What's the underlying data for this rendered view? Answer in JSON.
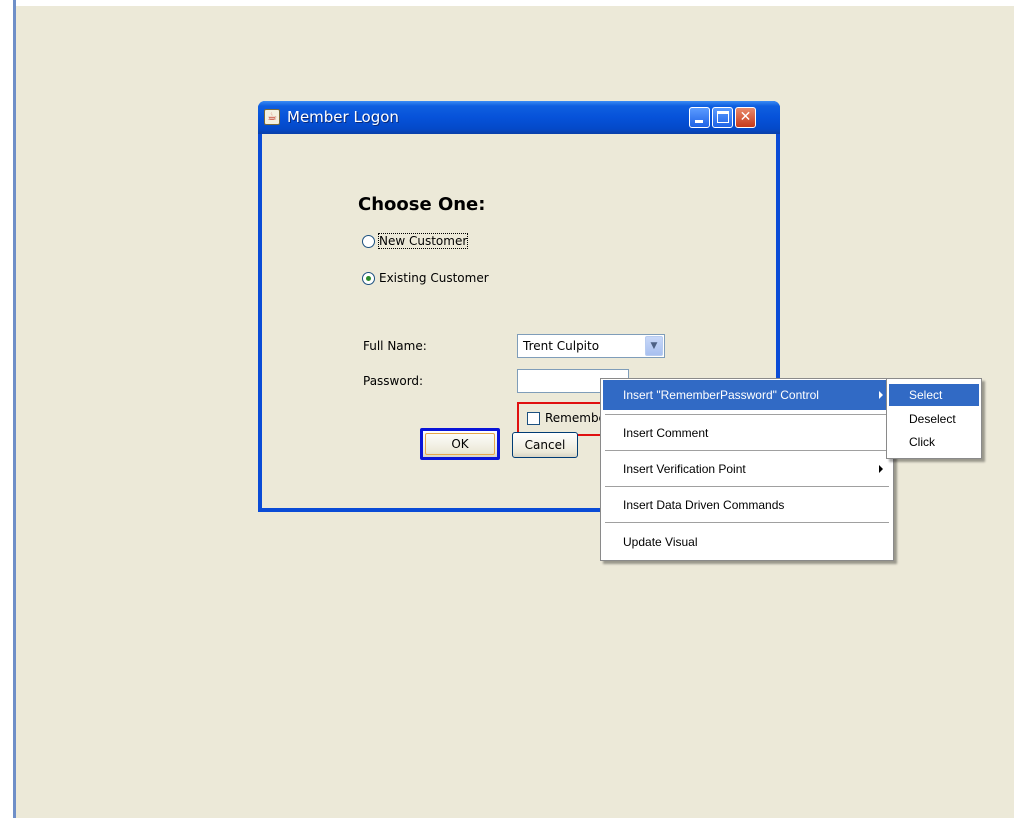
{
  "window": {
    "title": "Member Logon",
    "title_icon": "java-cup-icon",
    "controls": [
      "minimize",
      "maximize",
      "close"
    ]
  },
  "form": {
    "heading": "Choose One:",
    "radio_new": "New Customer",
    "radio_existing": "Existing Customer",
    "selected_radio": "Existing Customer",
    "full_name_label": "Full Name:",
    "full_name_value": "Trent Culpito",
    "password_label": "Password:",
    "password_value": "",
    "remember_label": "Remembe",
    "ok_label": "OK",
    "cancel_label": "Cancel"
  },
  "context_menu": {
    "items": [
      {
        "label": "Insert \"RememberPassword\" Control",
        "has_submenu": true,
        "active": true
      },
      {
        "label": "Insert Comment",
        "has_submenu": false
      },
      {
        "label": "Insert Verification Point",
        "has_submenu": true
      },
      {
        "label": "Insert Data Driven Commands",
        "has_submenu": false
      },
      {
        "label": "Update Visual",
        "has_submenu": false
      }
    ]
  },
  "submenu": {
    "items": [
      {
        "label": "Select",
        "active": true
      },
      {
        "label": "Deselect"
      },
      {
        "label": "Click"
      }
    ]
  },
  "colors": {
    "desktop": "#ece9d8",
    "titlebar": "#0652d9",
    "menu_highlight": "#316ac5",
    "highlight_border": "#e01010"
  }
}
